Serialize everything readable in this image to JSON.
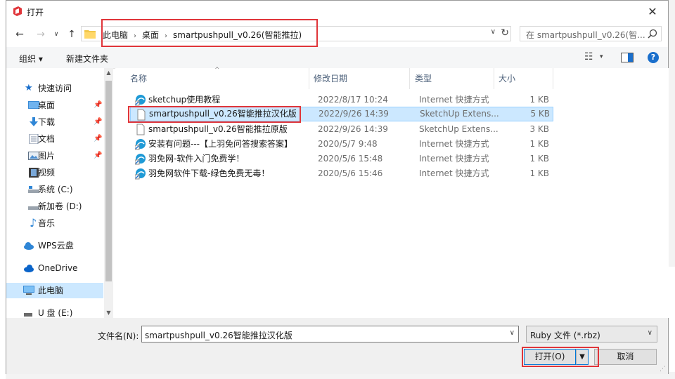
{
  "title": "打开",
  "address": {
    "crumbs": [
      "此电脑",
      "桌面",
      "smartpushpull_v0.26(智能推拉)"
    ],
    "search_placeholder": "在 smartpushpull_v0.26(智..."
  },
  "toolbar": {
    "organize": "组织 ▾",
    "new_folder": "新建文件夹"
  },
  "nav": {
    "items": [
      {
        "label": "快速访问",
        "icon": "star-icon"
      },
      {
        "label": "桌面",
        "icon": "desktop-icon",
        "pinned": true
      },
      {
        "label": "下载",
        "icon": "download-icon",
        "pinned": true
      },
      {
        "label": "文档",
        "icon": "document-icon",
        "pinned": true
      },
      {
        "label": "图片",
        "icon": "picture-icon",
        "pinned": true
      },
      {
        "label": "视频",
        "icon": "video-icon"
      },
      {
        "label": "系统 (C:)",
        "icon": "drive-icon"
      },
      {
        "label": "新加卷 (D:)",
        "icon": "drive-icon"
      },
      {
        "label": "音乐",
        "icon": "music-icon"
      },
      {
        "label": "WPS云盘",
        "icon": "cloud-icon"
      },
      {
        "label": "OneDrive",
        "icon": "cloud-icon"
      },
      {
        "label": "此电脑",
        "icon": "computer-icon",
        "selected": true
      },
      {
        "label": "U 盘 (E:)",
        "icon": "usb-drive-icon"
      }
    ]
  },
  "columns": {
    "name": "名称",
    "date": "修改日期",
    "type": "类型",
    "size": "大小"
  },
  "files": [
    {
      "name": "sketchup使用教程",
      "date": "2022/8/17 10:24",
      "type": "Internet 快捷方式",
      "size": "1 KB",
      "icon": "internet-shortcut-icon"
    },
    {
      "name": "smartpushpull_v0.26智能推拉汉化版",
      "date": "2022/9/26 14:39",
      "type": "SketchUp Extens...",
      "size": "5 KB",
      "icon": "file-icon",
      "selected": true
    },
    {
      "name": "smartpushpull_v0.26智能推拉原版",
      "date": "2022/9/26 14:39",
      "type": "SketchUp Extens...",
      "size": "3 KB",
      "icon": "file-icon"
    },
    {
      "name": "安装有问题---【上羽免问答搜索答案】",
      "date": "2020/5/7 9:48",
      "type": "Internet 快捷方式",
      "size": "1 KB",
      "icon": "internet-shortcut-icon"
    },
    {
      "name": "羽免网-软件入门免费学！",
      "date": "2020/5/6 15:48",
      "type": "Internet 快捷方式",
      "size": "1 KB",
      "icon": "internet-shortcut-icon"
    },
    {
      "name": "羽免网软件下载-绿色免费无毒！",
      "date": "2020/5/6 15:46",
      "type": "Internet 快捷方式",
      "size": "1 KB",
      "icon": "internet-shortcut-icon"
    }
  ],
  "bottom": {
    "filename_label": "文件名(N):",
    "filename_value": "smartpushpull_v0.26智能推拉汉化版",
    "filetype_value": "Ruby 文件 (*.rbz)",
    "open_label": "打开(O)",
    "cancel_label": "取消"
  },
  "colors": {
    "highlight": "#e0353a",
    "selection": "#cce8ff",
    "accent": "#0078d7"
  }
}
